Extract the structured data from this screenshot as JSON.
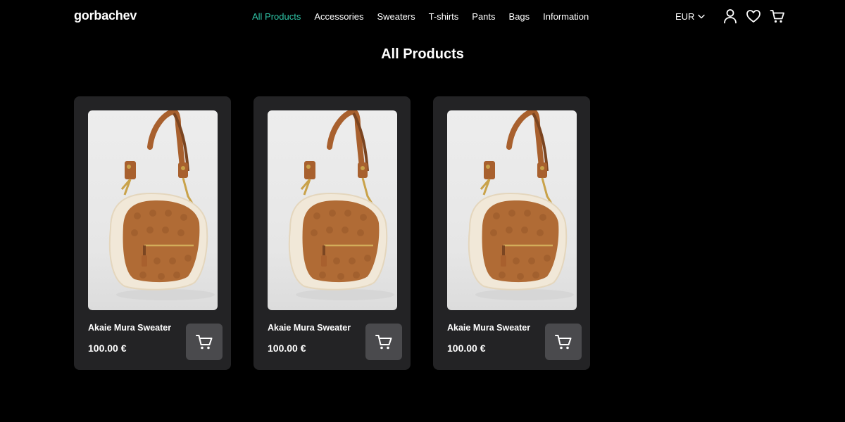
{
  "header": {
    "logo": "gorbachev",
    "nav": [
      {
        "label": "All Products",
        "active": true
      },
      {
        "label": "Accessories",
        "active": false
      },
      {
        "label": "Sweaters",
        "active": false
      },
      {
        "label": "T-shirts",
        "active": false
      },
      {
        "label": "Pants",
        "active": false
      },
      {
        "label": "Bags",
        "active": false
      },
      {
        "label": "Information",
        "active": false
      }
    ],
    "currency": "EUR",
    "icons": [
      "user-icon",
      "heart-icon",
      "cart-icon"
    ]
  },
  "page": {
    "title": "All Products"
  },
  "products": [
    {
      "name": "Akaie Mura Sweater",
      "price": "100.00 €",
      "image": "brown-shoulder-bag-with-shearling-trim"
    },
    {
      "name": "Akaie Mura Sweater",
      "price": "100.00 €",
      "image": "brown-shoulder-bag-with-shearling-trim"
    },
    {
      "name": "Akaie Mura Sweater",
      "price": "100.00 €",
      "image": "brown-shoulder-bag-with-shearling-trim"
    }
  ],
  "colors": {
    "background": "#000000",
    "card": "#232325",
    "accent": "#2fc5a7",
    "cart_button": "#4a4a4d"
  }
}
